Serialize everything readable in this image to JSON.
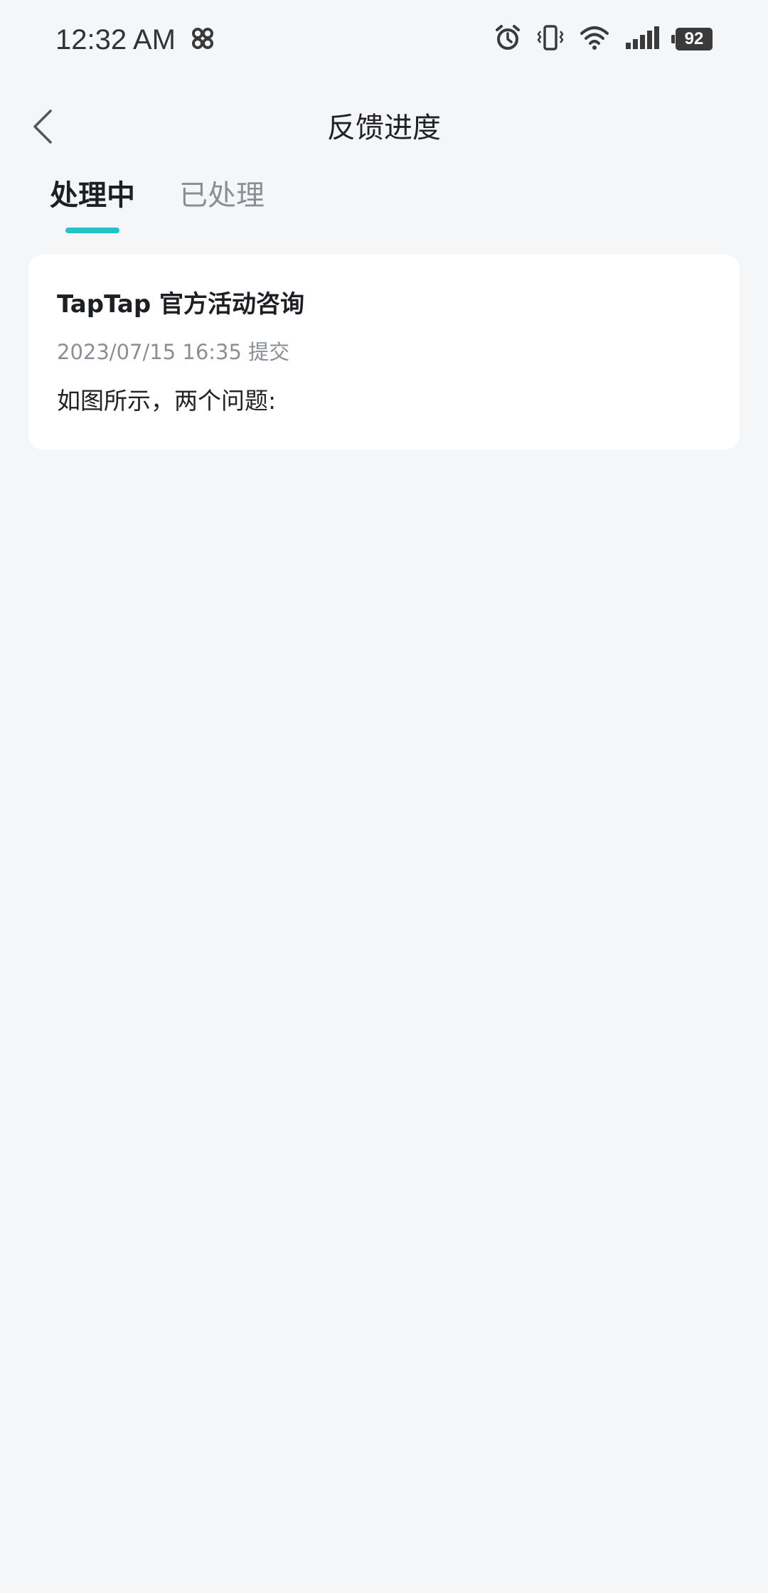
{
  "status_bar": {
    "time": "12:32 AM",
    "battery": "92",
    "icons": [
      "carrier-knot-icon",
      "alarm-icon",
      "vibrate-icon",
      "wifi-icon",
      "signal-icon",
      "battery-icon"
    ]
  },
  "header": {
    "title": "反馈进度",
    "back_icon": "chevron-left-icon"
  },
  "tabs": [
    {
      "label": "处理中",
      "active": true
    },
    {
      "label": "已处理",
      "active": false
    }
  ],
  "colors": {
    "accent": "#1cc5c9",
    "background": "#f5f6f8",
    "card": "#ffffff",
    "text_primary": "#1d1f24",
    "text_secondary": "#8a8f97"
  },
  "feedback_items": [
    {
      "title": "TapTap 官方活动咨询",
      "timestamp": "2023/07/15 16:35 提交",
      "content": "如图所示，两个问题:"
    }
  ]
}
